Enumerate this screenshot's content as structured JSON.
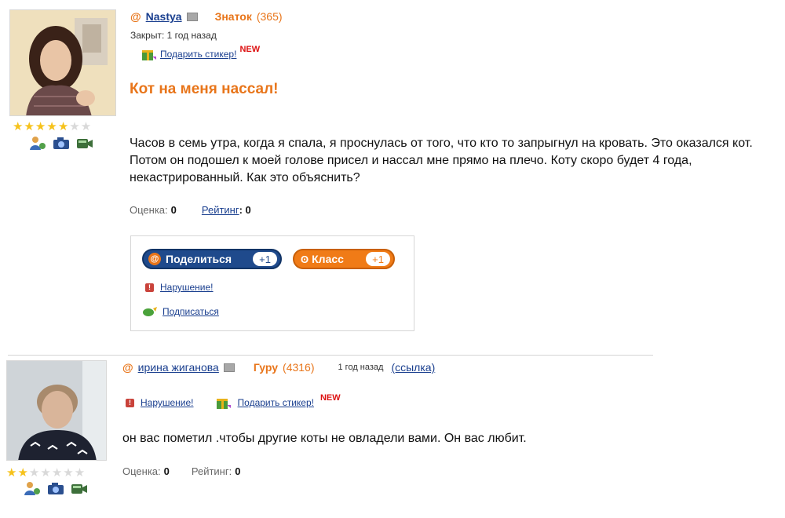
{
  "question": {
    "username": "Nastya",
    "rank": "Знаток",
    "rank_count": "(365)",
    "closed": "Закрыт: 1 год назад",
    "gift_link": "Подарить стикер!",
    "new_badge": "NEW",
    "title": "Кот на меня нассал!",
    "body": "Часов в семь утра, когда я спала, я проснулась от того, что кто то запрыгнул на кровать. Это оказался кот. Потом он подошел к моей голове присел и нассал мне прямо на плечо. Коту скоро будет 4 года, некастрированный. Как это объяснить?",
    "score_label": "Оценка:",
    "score_value": "0",
    "rating_label": "Рейтинг",
    "rating_value": ": 0",
    "stars_filled": 5,
    "stars_total": 7
  },
  "share_box": {
    "share_label": "Поделиться",
    "share_count": "+1",
    "class_label": "Класс",
    "class_count": "+1",
    "report_link": "Нарушение!",
    "subscribe_link": "Подписаться"
  },
  "answer": {
    "username": "ирина жиганова",
    "rank": "Гуру",
    "rank_count": "(4316)",
    "time": "1 год назад",
    "link_label": "(ссылка)",
    "report_link": "Нарушение!",
    "gift_link": "Подарить стикер!",
    "new_badge": "NEW",
    "body": "он вас пометил .чтобы другие коты не овладели вами. Он вас любит.",
    "score_label": "Оценка:",
    "score_value": "0",
    "rating_label": "Рейтинг:",
    "rating_value": "0",
    "stars_filled": 2,
    "stars_total": 7
  },
  "colors": {
    "accent": "#e8751a",
    "link": "#1a3f8f",
    "share_button": "#1f4a8c",
    "class_button": "#f07b17"
  },
  "icons": [
    "at-icon",
    "mailbox-icon",
    "gift-icon",
    "user-contact-icon",
    "camera-icon",
    "video-icon",
    "report-icon",
    "subscribe-icon",
    "star-icon"
  ]
}
